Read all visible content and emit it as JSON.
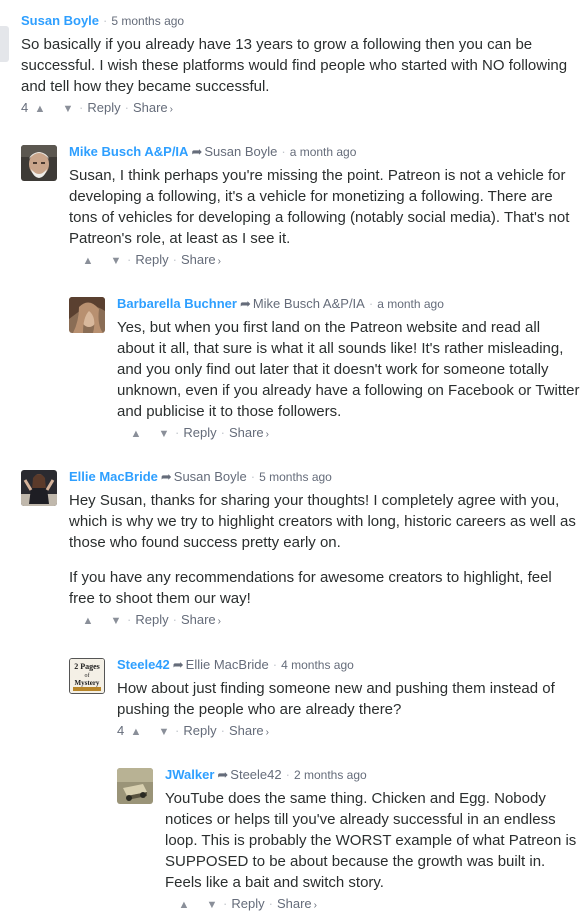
{
  "separator": "·",
  "arrow": "➦",
  "comments": [
    {
      "author": "Susan Boyle",
      "parent": "",
      "time": "5 months ago",
      "paragraphs": [
        "So basically if you already have 13 years to grow a following then you can be successful. I wish these platforms would find people who started with NO following and tell how they became successful."
      ],
      "votes": "4",
      "reply_label": "Reply",
      "share_label": "Share",
      "share_chevron": "›"
    },
    {
      "author": "Mike Busch A&P/IA",
      "parent": "Susan Boyle",
      "time": "a month ago",
      "paragraphs": [
        "Susan, I think perhaps you're missing the point. Patreon is not a vehicle for developing a following, it's a vehicle for monetizing a following. There are tons of vehicles for developing a following (notably social media). That's not Patreon's role, at least as I see it."
      ],
      "votes": "",
      "reply_label": "Reply",
      "share_label": "Share",
      "share_chevron": "›"
    },
    {
      "author": "Barbarella Buchner",
      "parent": "Mike Busch A&P/IA",
      "time": "a month ago",
      "paragraphs": [
        "Yes, but when you first land on the Patreon website and read all about it all, that sure is what it all sounds like! It's rather misleading, and you only find out later that it doesn't work for someone totally unknown, even if you already have a following on Facebook or Twitter and publicise it to those followers."
      ],
      "votes": "",
      "reply_label": "Reply",
      "share_label": "Share",
      "share_chevron": "›"
    },
    {
      "author": "Ellie MacBride",
      "parent": "Susan Boyle",
      "time": "5 months ago",
      "paragraphs": [
        "Hey Susan, thanks for sharing your thoughts! I completely agree with you, which is why we try to highlight creators with long, historic careers as well as those who found success pretty early on.",
        "If you have any recommendations for awesome creators to highlight, feel free to shoot them our way!"
      ],
      "votes": "",
      "reply_label": "Reply",
      "share_label": "Share",
      "share_chevron": "›"
    },
    {
      "author": "Steele42",
      "parent": "Ellie MacBride",
      "time": "4 months ago",
      "paragraphs": [
        "How about just finding someone new and pushing them instead of pushing the people who are already there?"
      ],
      "votes": "4",
      "reply_label": "Reply",
      "share_label": "Share",
      "share_chevron": "›"
    },
    {
      "author": "JWalker",
      "parent": "Steele42",
      "time": "2 months ago",
      "paragraphs": [
        "YouTube does the same thing. Chicken and Egg. Nobody notices or helps till you've already successful in an endless loop. This is probably the WORST example of what Patreon is SUPPOSED to be about because the growth was built in. Feels like a bait and switch story."
      ],
      "votes": "",
      "reply_label": "Reply",
      "share_label": "Share",
      "share_chevron": "›"
    }
  ],
  "avatar_logo_text": [
    "2 Pages",
    "of",
    "Mystery"
  ],
  "colors": {
    "author": "#2e9fff",
    "meta": "#656c7a",
    "text": "#2a2e2e",
    "separator": "#c2c6cc"
  }
}
